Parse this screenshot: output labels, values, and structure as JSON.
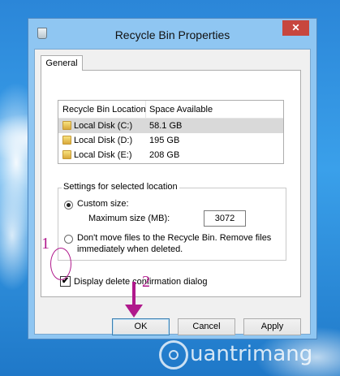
{
  "window": {
    "title": "Recycle Bin Properties",
    "close_glyph": "✕"
  },
  "tabs": [
    {
      "label": "General"
    }
  ],
  "list": {
    "columns": [
      "Recycle Bin Location",
      "Space Available"
    ],
    "rows": [
      {
        "location": "Local Disk (C:)",
        "space": "58.1 GB",
        "selected": true
      },
      {
        "location": "Local Disk (D:)",
        "space": "195 GB",
        "selected": false
      },
      {
        "location": "Local Disk (E:)",
        "space": "208 GB",
        "selected": false
      }
    ]
  },
  "settings": {
    "group_label": "Settings for selected location",
    "custom_size_label": "Custom size:",
    "custom_size_checked": true,
    "max_size_label": "Maximum size (MB):",
    "max_size_value": "3072",
    "no_move_label_line1": "Don't move files to the Recycle Bin. Remove files",
    "no_move_label_line2": "immediately when deleted.",
    "no_move_checked": false
  },
  "confirm": {
    "label": "Display delete confirmation dialog",
    "checked": true,
    "check_glyph": "✔"
  },
  "buttons": {
    "ok": "OK",
    "cancel": "Cancel",
    "apply": "Apply"
  },
  "annotations": {
    "step1": "1",
    "step2": "2",
    "color": "#b0198c"
  },
  "watermark": {
    "text": "uantrimang"
  }
}
